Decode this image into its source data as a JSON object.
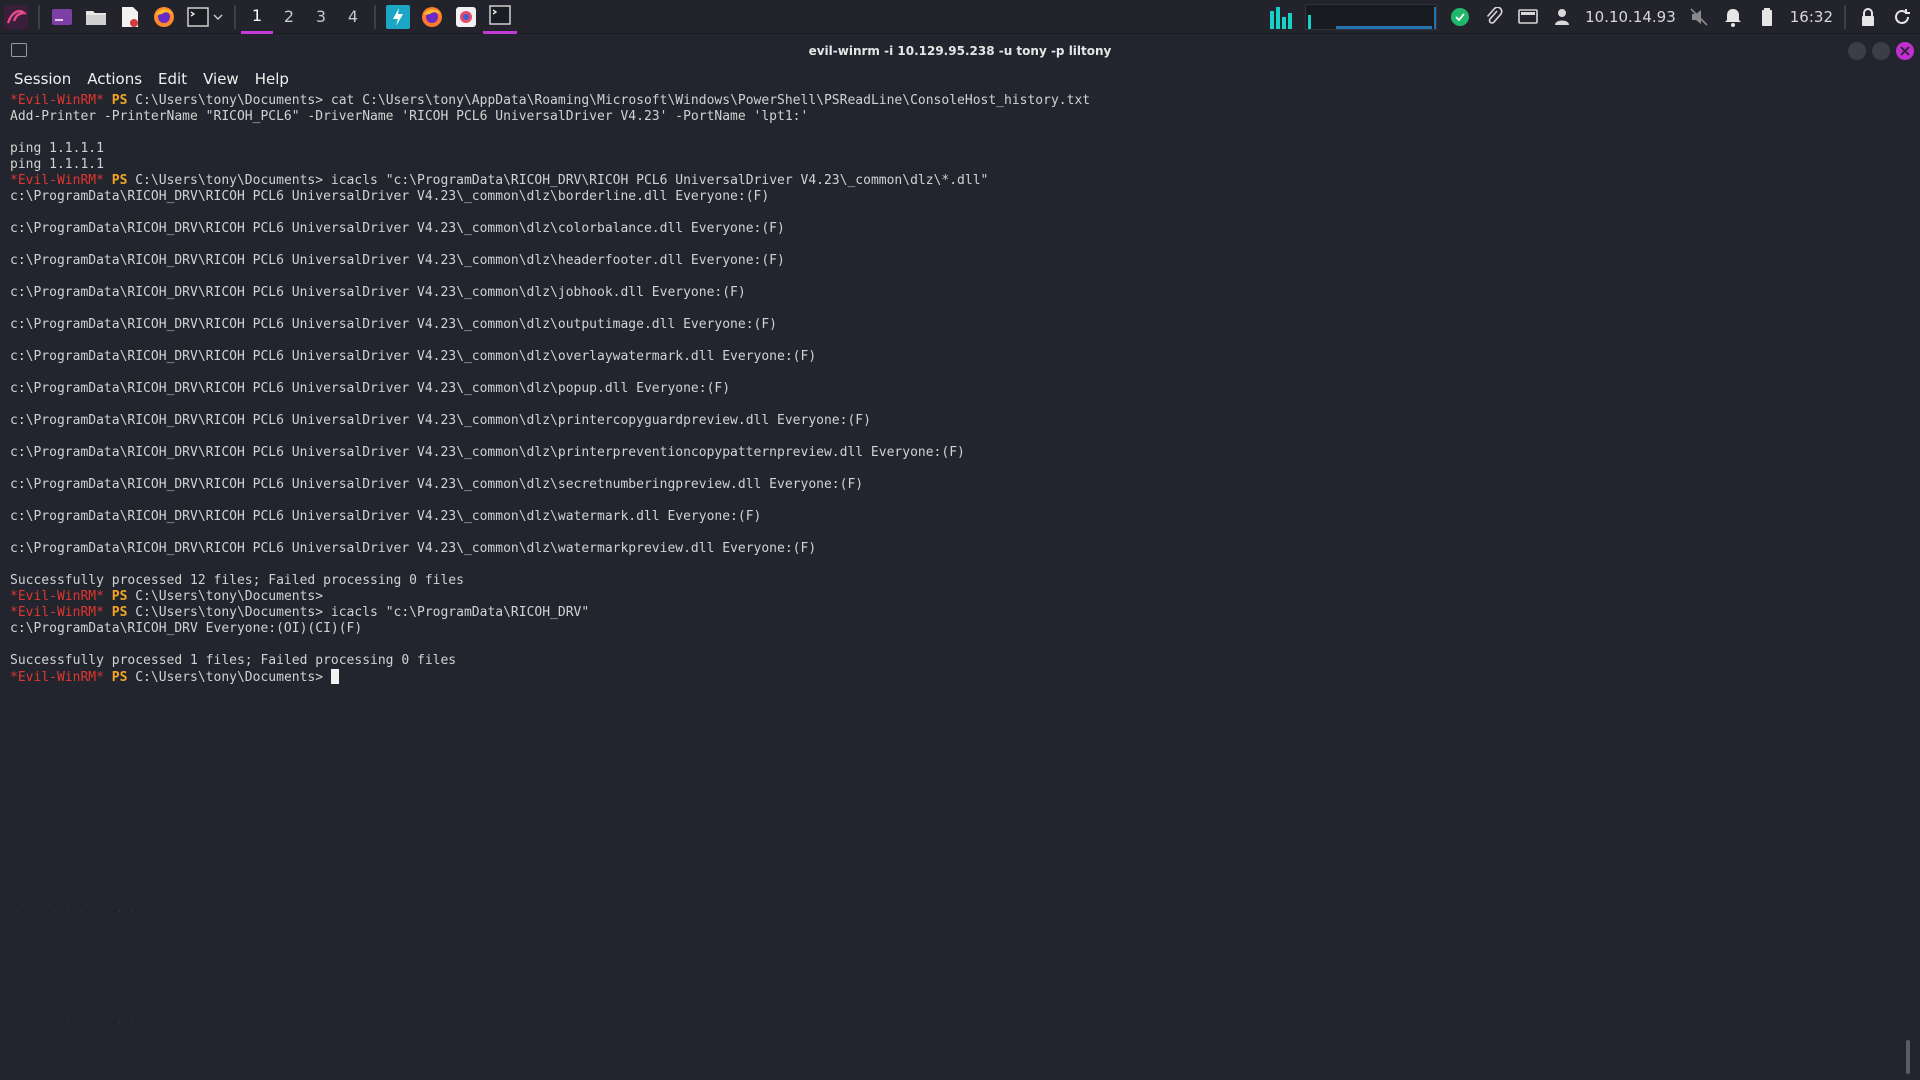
{
  "panel": {
    "workspaces": [
      "1",
      "2",
      "3",
      "4"
    ],
    "active_workspace": "1",
    "tray": {
      "ip": "10.10.14.93",
      "time": "16:32"
    }
  },
  "window": {
    "title": "evil-winrm -i 10.129.95.238 -u tony -p liltony",
    "menu": [
      "Session",
      "Actions",
      "Edit",
      "View",
      "Help"
    ]
  },
  "prompt": {
    "evil": "*Evil-WinRM*",
    "ps": "PS"
  },
  "terminal_lines": [
    {
      "type": "prompt",
      "path": "C:\\Users\\tony\\Documents>",
      "cmd": " cat C:\\Users\\tony\\AppData\\Roaming\\Microsoft\\Windows\\PowerShell\\PSReadLine\\ConsoleHost_history.txt"
    },
    {
      "type": "out",
      "text": "Add-Printer -PrinterName \"RICOH_PCL6\" -DriverName 'RICOH PCL6 UniversalDriver V4.23' -PortName 'lpt1:'"
    },
    {
      "type": "out",
      "text": ""
    },
    {
      "type": "out",
      "text": "ping 1.1.1.1"
    },
    {
      "type": "out",
      "text": "ping 1.1.1.1"
    },
    {
      "type": "prompt",
      "path": "C:\\Users\\tony\\Documents>",
      "cmd": " icacls \"c:\\ProgramData\\RICOH_DRV\\RICOH PCL6 UniversalDriver V4.23\\_common\\dlz\\*.dll\""
    },
    {
      "type": "out",
      "text": "c:\\ProgramData\\RICOH_DRV\\RICOH PCL6 UniversalDriver V4.23\\_common\\dlz\\borderline.dll Everyone:(F)"
    },
    {
      "type": "out",
      "text": ""
    },
    {
      "type": "out",
      "text": "c:\\ProgramData\\RICOH_DRV\\RICOH PCL6 UniversalDriver V4.23\\_common\\dlz\\colorbalance.dll Everyone:(F)"
    },
    {
      "type": "out",
      "text": ""
    },
    {
      "type": "out",
      "text": "c:\\ProgramData\\RICOH_DRV\\RICOH PCL6 UniversalDriver V4.23\\_common\\dlz\\headerfooter.dll Everyone:(F)"
    },
    {
      "type": "out",
      "text": ""
    },
    {
      "type": "out",
      "text": "c:\\ProgramData\\RICOH_DRV\\RICOH PCL6 UniversalDriver V4.23\\_common\\dlz\\jobhook.dll Everyone:(F)"
    },
    {
      "type": "out",
      "text": ""
    },
    {
      "type": "out",
      "text": "c:\\ProgramData\\RICOH_DRV\\RICOH PCL6 UniversalDriver V4.23\\_common\\dlz\\outputimage.dll Everyone:(F)"
    },
    {
      "type": "out",
      "text": ""
    },
    {
      "type": "out",
      "text": "c:\\ProgramData\\RICOH_DRV\\RICOH PCL6 UniversalDriver V4.23\\_common\\dlz\\overlaywatermark.dll Everyone:(F)"
    },
    {
      "type": "out",
      "text": ""
    },
    {
      "type": "out",
      "text": "c:\\ProgramData\\RICOH_DRV\\RICOH PCL6 UniversalDriver V4.23\\_common\\dlz\\popup.dll Everyone:(F)"
    },
    {
      "type": "out",
      "text": ""
    },
    {
      "type": "out",
      "text": "c:\\ProgramData\\RICOH_DRV\\RICOH PCL6 UniversalDriver V4.23\\_common\\dlz\\printercopyguardpreview.dll Everyone:(F)"
    },
    {
      "type": "out",
      "text": ""
    },
    {
      "type": "out",
      "text": "c:\\ProgramData\\RICOH_DRV\\RICOH PCL6 UniversalDriver V4.23\\_common\\dlz\\printerpreventioncopypatternpreview.dll Everyone:(F)"
    },
    {
      "type": "out",
      "text": ""
    },
    {
      "type": "out",
      "text": "c:\\ProgramData\\RICOH_DRV\\RICOH PCL6 UniversalDriver V4.23\\_common\\dlz\\secretnumberingpreview.dll Everyone:(F)"
    },
    {
      "type": "out",
      "text": ""
    },
    {
      "type": "out",
      "text": "c:\\ProgramData\\RICOH_DRV\\RICOH PCL6 UniversalDriver V4.23\\_common\\dlz\\watermark.dll Everyone:(F)"
    },
    {
      "type": "out",
      "text": ""
    },
    {
      "type": "out",
      "text": "c:\\ProgramData\\RICOH_DRV\\RICOH PCL6 UniversalDriver V4.23\\_common\\dlz\\watermarkpreview.dll Everyone:(F)"
    },
    {
      "type": "out",
      "text": ""
    },
    {
      "type": "out",
      "text": "Successfully processed 12 files; Failed processing 0 files"
    },
    {
      "type": "prompt",
      "path": "C:\\Users\\tony\\Documents>",
      "cmd": ""
    },
    {
      "type": "prompt",
      "path": "C:\\Users\\tony\\Documents>",
      "cmd": " icacls \"c:\\ProgramData\\RICOH_DRV\""
    },
    {
      "type": "out",
      "text": "c:\\ProgramData\\RICOH_DRV Everyone:(OI)(CI)(F)"
    },
    {
      "type": "out",
      "text": ""
    },
    {
      "type": "out",
      "text": "Successfully processed 1 files; Failed processing 0 files"
    },
    {
      "type": "prompt",
      "path": "C:\\Users\\tony\\Documents>",
      "cmd": " ",
      "cursor": true
    }
  ],
  "colors": {
    "accent": "#c23bd6",
    "prompt_red": "#e0362f",
    "prompt_orange": "#f5a623",
    "bg": "#23252e"
  }
}
